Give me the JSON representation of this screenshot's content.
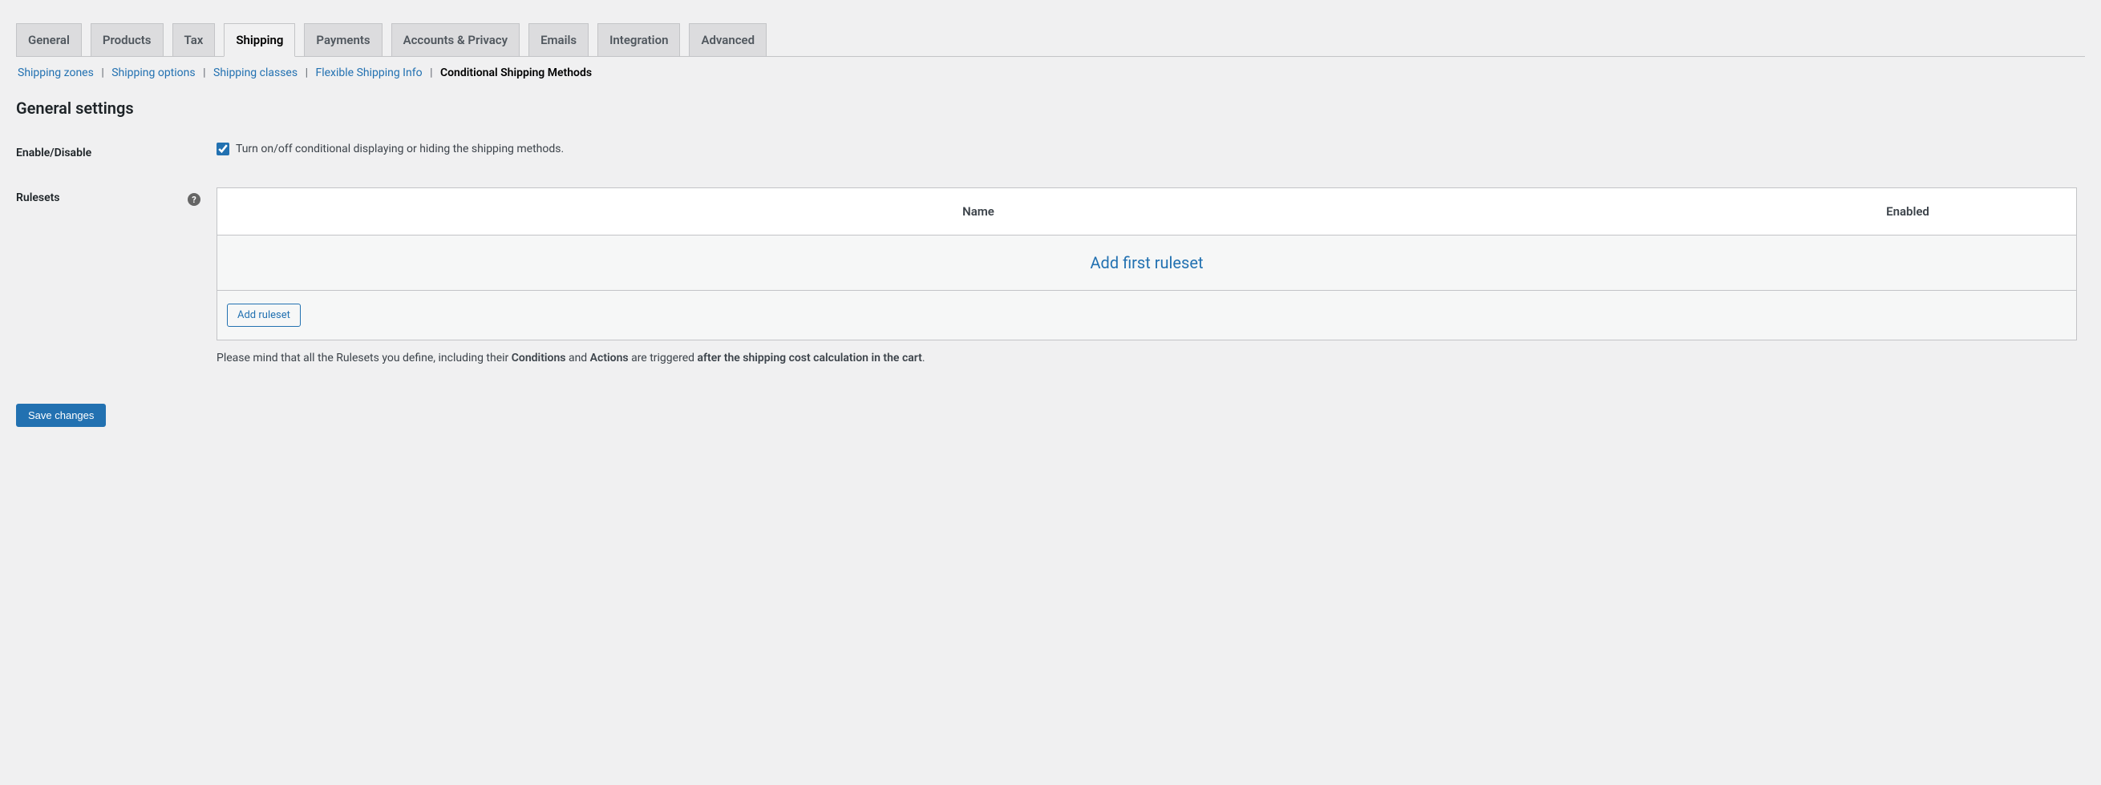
{
  "tabs": [
    {
      "label": "General",
      "active": false
    },
    {
      "label": "Products",
      "active": false
    },
    {
      "label": "Tax",
      "active": false
    },
    {
      "label": "Shipping",
      "active": true
    },
    {
      "label": "Payments",
      "active": false
    },
    {
      "label": "Accounts & Privacy",
      "active": false
    },
    {
      "label": "Emails",
      "active": false
    },
    {
      "label": "Integration",
      "active": false
    },
    {
      "label": "Advanced",
      "active": false
    }
  ],
  "subnav": {
    "items": [
      {
        "label": "Shipping zones",
        "current": false
      },
      {
        "label": "Shipping options",
        "current": false
      },
      {
        "label": "Shipping classes",
        "current": false
      },
      {
        "label": "Flexible Shipping Info",
        "current": false
      },
      {
        "label": "Conditional Shipping Methods",
        "current": true
      }
    ],
    "separator": "|"
  },
  "section_title": "General settings",
  "fields": {
    "enable": {
      "label": "Enable/Disable",
      "description": "Turn on/off conditional displaying or hiding the shipping methods.",
      "checked": true
    },
    "rulesets": {
      "label": "Rulesets",
      "help_glyph": "?",
      "columns": {
        "name": "Name",
        "enabled": "Enabled"
      },
      "empty_link": "Add first ruleset",
      "add_button": "Add ruleset",
      "note_parts": {
        "p1": "Please mind that all the Rulesets you define, including their ",
        "s1": "Conditions",
        "p2": " and ",
        "s2": "Actions",
        "p3": " are triggered ",
        "s3": "after the shipping cost calculation in the cart",
        "p4": "."
      }
    }
  },
  "save_button": "Save changes"
}
